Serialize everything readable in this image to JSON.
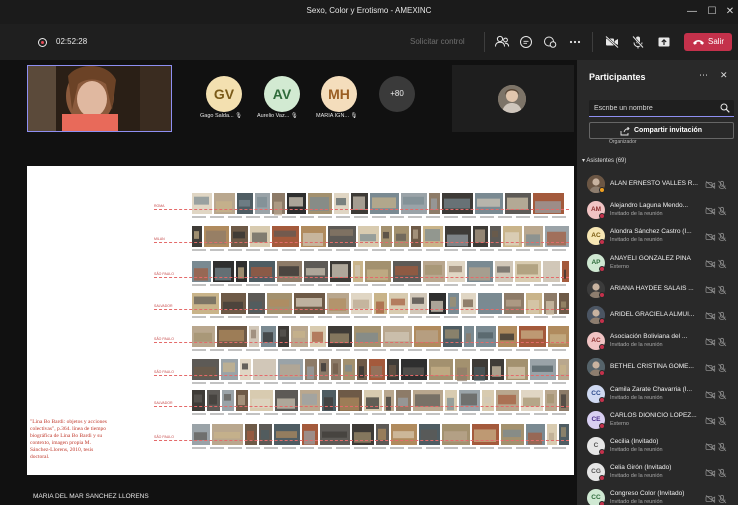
{
  "window": {
    "title": "Sexo, Color y Erotismo - AMEXINC",
    "controls": [
      "minimize-icon",
      "maximize-icon",
      "close-icon"
    ]
  },
  "toolbar": {
    "timer": "02:52:28",
    "request_control": "Solicitar control",
    "icons": [
      "participants-icon",
      "chat-icon",
      "reactions-icon",
      "more-icon",
      "camera-off-icon",
      "mic-off-icon",
      "share-icon"
    ],
    "leave_label": "Salir",
    "leave_color": "#c4314b"
  },
  "stage": {
    "avatars": [
      {
        "initials": "GV",
        "name": "Gago Salda...",
        "bg": "#f3e0b0",
        "fg": "#7a5a18"
      },
      {
        "initials": "AV",
        "name": "Aurelio Vaz...",
        "bg": "#d2ead2",
        "fg": "#2f6b3a"
      },
      {
        "initials": "MH",
        "name": "MARIA IGN...",
        "bg": "#f4ddbc",
        "fg": "#9a5d22"
      }
    ],
    "more_count": "+80",
    "presenter_name": "MARIA DEL MAR SANCHEZ LLORENS"
  },
  "slide": {
    "rows": [
      {
        "label": "ROMA"
      },
      {
        "label": "MILAN"
      },
      {
        "label": "SÃO PAULO"
      },
      {
        "label": "SALVADOR"
      },
      {
        "label": "SÃO PAULO"
      },
      {
        "label": "SÃO PAULO"
      },
      {
        "label": "SALVADOR"
      },
      {
        "label": "SÃO PAULO"
      }
    ],
    "note": "\"Lina Bo Bardi: objetos y acciones colectivas\", p.364. línea de tiempo biográfica de Lina Bo Bardi y su contexto, imagen propia M. Sánchez-Llorens, 2010, tesis doctoral."
  },
  "panel": {
    "title": "Participantes",
    "search_placeholder": "Escribe un nombre",
    "share_invite": "Compartir invitación",
    "organizer_stub": "Organizador",
    "attendees_header": "Asistentes (69)",
    "participants": [
      {
        "name": "ALAN ERNESTO VALLES R...",
        "role": "",
        "initials": "",
        "bg": "#6b5644",
        "photo": true,
        "status": "#f0a020"
      },
      {
        "name": "Alejandro Laguna Mendo...",
        "role": "Invitado de la reunión",
        "initials": "AM",
        "bg": "#f1c4c4",
        "fg": "#8b2f2f",
        "status": "#c4314b"
      },
      {
        "name": "Alondra Sánchez Castro (I...",
        "role": "Invitado de la reunión",
        "initials": "AC",
        "bg": "#f6e6b3",
        "fg": "#7a5a10",
        "status": "#c4314b"
      },
      {
        "name": "ANAYELI GONZALEZ PIÑA",
        "role": "Externo",
        "initials": "AP",
        "bg": "#cfe8d2",
        "fg": "#2e6b3b",
        "status": "#c4314b"
      },
      {
        "name": "ARIANA HAYDEE SALAIS ...",
        "role": "",
        "initials": "",
        "bg": "#3b3b3b",
        "photo": true,
        "status": "#c4314b"
      },
      {
        "name": "ARIDEL GRACIELA ALMUI...",
        "role": "",
        "initials": "",
        "bg": "#4b5563",
        "photo": true,
        "status": "#c4314b"
      },
      {
        "name": "Asociación Boliviana del ...",
        "role": "Invitado de la reunión",
        "initials": "AC",
        "bg": "#f1c4c4",
        "fg": "#8b2f2f",
        "status": "#c4314b"
      },
      {
        "name": "BETHEL CRISTINA GOME...",
        "role": "",
        "initials": "",
        "bg": "#55636a",
        "photo": true,
        "status": "#c4314b"
      },
      {
        "name": "Camila Zarate Chavarria (I...",
        "role": "Invitado de la reunión",
        "initials": "CC",
        "bg": "#cfd9f2",
        "fg": "#2b4a8b",
        "status": "#c4314b"
      },
      {
        "name": "CARLOS DIONICIO LOPEZ...",
        "role": "Externo",
        "initials": "CE",
        "bg": "#d8cff2",
        "fg": "#4b2f8b",
        "status": "#c4314b"
      },
      {
        "name": "Cecilia (Invitado)",
        "role": "Invitado de la reunión",
        "initials": "C",
        "bg": "#e6e6e6",
        "fg": "#555555",
        "status": "#c4314b"
      },
      {
        "name": "Celia Girón (Invitado)",
        "role": "Invitado de la reunión",
        "initials": "CG",
        "bg": "#e6e6e6",
        "fg": "#555555",
        "status": "#c4314b"
      },
      {
        "name": "Congreso Color (Invitado)",
        "role": "Invitado de la reunión",
        "initials": "CC",
        "bg": "#cfe8d2",
        "fg": "#2e6b3b",
        "status": "#c4314b"
      }
    ]
  },
  "colors": {
    "accent": "#8e8ff2",
    "leave": "#c4314b",
    "slide_red": "#c54949"
  }
}
